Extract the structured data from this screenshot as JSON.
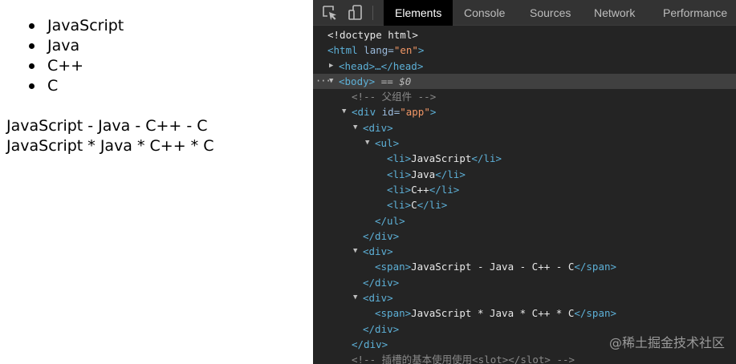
{
  "page": {
    "list_items": [
      "JavaScript",
      "Java",
      "C++",
      "C"
    ],
    "line1": "JavaScript - Java - C++ - C",
    "line2": "JavaScript * Java * C++ * C"
  },
  "devtools": {
    "icons": [
      "inspect-element-icon",
      "device-toolbar-icon"
    ],
    "tabs": [
      "Elements",
      "Console",
      "Sources",
      "Network",
      "Performance"
    ],
    "active_tab": "Elements",
    "dom": {
      "doctype": "<!doctype html>",
      "html_open": "<html",
      "html_attr": "lang",
      "html_val": "\"en\"",
      "head_collapsed": "<head>…</head>",
      "body": "<body>",
      "body_marker": "== $0",
      "comment_parent": "<!-- 父组件 -->",
      "div_app_open": "<div",
      "div_app_attr": "id",
      "div_app_val": "\"app\"",
      "div_open": "<div>",
      "ul_open": "<ul>",
      "li_items": [
        "JavaScript",
        "Java",
        "C++",
        "C"
      ],
      "ul_close": "</ul>",
      "div_close": "</div>",
      "span1_text": "JavaScript - Java - C++ - C",
      "span2_text": "JavaScript * Java * C++ * C",
      "comment_slot": "<!-- 插槽的基本使用使用<slot></slot> -->"
    }
  },
  "watermark": "@稀土掘金技术社区"
}
